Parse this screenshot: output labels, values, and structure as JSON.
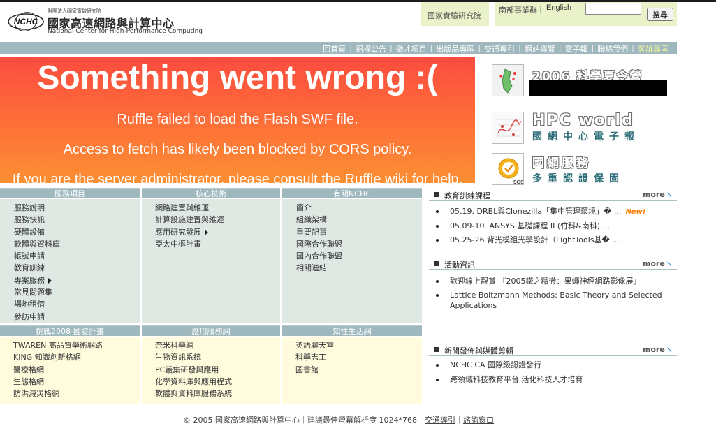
{
  "header": {
    "logo_mark": "NCHC",
    "logo_org": "財團法人國家實驗研究院",
    "logo_cn": "國家高速網路與計算中心",
    "logo_en": "National Center for High-Performance Computing",
    "lab_link": "國家實驗研究院",
    "south_link": "南部事業群",
    "separator": "|",
    "english_link": "English",
    "search_value": "",
    "search_button": "搜尋"
  },
  "nav": {
    "items": [
      "回首頁",
      "招標公告",
      "徵才項目",
      "出版品專區",
      "交通導引",
      "網站導覽",
      "電子報",
      "聯絡我們",
      "客訴專區"
    ],
    "separator": "|"
  },
  "error": {
    "title": "Something went wrong :(",
    "line1": "Ruffle failed to load the Flash SWF file.",
    "line2": "Access to fetch has likely been blocked by CORS policy.",
    "line3": "If you are the server administrator, please consult the Ruffle wiki for help."
  },
  "promos": [
    {
      "title": "2006 科學夏令營",
      "subtitle": ""
    },
    {
      "title": "HPC world",
      "subtitle": "國網中心電子報"
    },
    {
      "title": "國網服務",
      "subtitle": "多重認證保固"
    }
  ],
  "services": {
    "col1": {
      "title": "服務項目",
      "items": [
        "服務說明",
        "服務快訊",
        "硬體設備",
        "軟體與資料庫",
        "帳號申請",
        "教育訓練",
        "專案服務",
        "常見問題集",
        "場地租借",
        "參訪申請"
      ]
    },
    "col2": {
      "title": "核心技術",
      "items": [
        "網路建置與維運",
        "計算設施建置與維運",
        "應用研究發展",
        "亞太中樞計畫"
      ]
    },
    "col3": {
      "title": "有關NCHC",
      "items": [
        "簡介",
        "組織架構",
        "重要記事",
        "國際合作聯盟",
        "國內合作聯盟",
        "相關連結"
      ]
    },
    "col4": {
      "title": "挑戰2008-國發計畫",
      "items": [
        "TWAREN 高品質學術網路",
        "KING 知識創新格網",
        "醫療格網",
        "生態格網",
        "防洪減災格網"
      ]
    },
    "col5": {
      "title": "應用服務網",
      "items": [
        "奈米科學網",
        "生物資訊系統",
        "PC叢集研發與應用",
        "化學資料庫與應用程式",
        "軟體與資料庫服務系統"
      ]
    },
    "col6": {
      "title": "知性生活網",
      "items": [
        "英語聊天室",
        "科學志工",
        "圖書館"
      ]
    }
  },
  "news": {
    "more_label": "more",
    "training": {
      "title": "教育訓練課程",
      "items": [
        "05.19. DRBL與Clonezilla「集中管理環境」� ...",
        "05.09-10. ANSYS 基礎課程 II (竹科&南科) ...",
        "05.25-26 背光模組光學設計（LightTools基� ..."
      ],
      "new_badge": "New!"
    },
    "events": {
      "title": "活動資訊",
      "items": [
        "歡迎線上觀賞 『2005鐵之精微：果蠅神經網路影像展』",
        "Lattice Boltzmann Methods: Basic Theory and Selected Applications"
      ]
    },
    "press": {
      "title": "新聞發佈與媒體剪輯",
      "items": [
        "NCHC CA 國際級認證發行",
        "跨領域科技教育平台 活化科技人才培育"
      ]
    }
  },
  "footer": {
    "copyright": "© 2005 國家高速網路與計算中心｜建議最佳螢幕解析度 1024*768｜",
    "traffic": "交通導引",
    "sep": "｜",
    "consult": "諮詢窗口"
  }
}
